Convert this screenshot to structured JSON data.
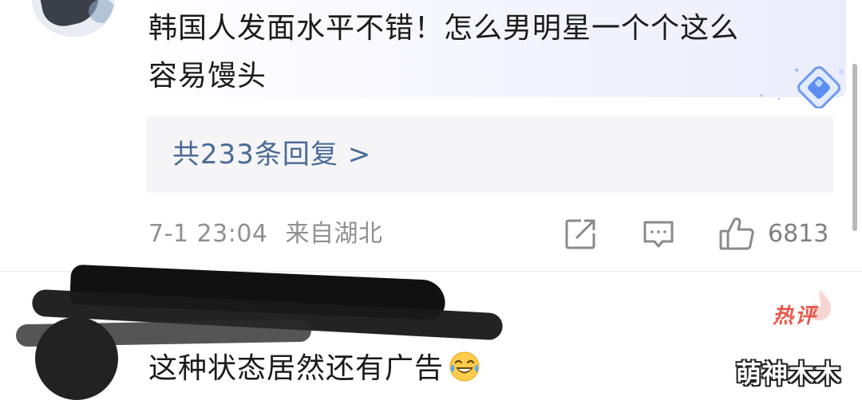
{
  "comment1": {
    "text_line1": "韩国人发面水平不错！怎么男明星一个个这么",
    "text_line2": "容易馒头",
    "replies_label": "共233条回复 >",
    "timestamp": "7-1 23:04",
    "location": "来自湖北",
    "like_count": "6813"
  },
  "comment2": {
    "hot_badge": "热评",
    "text": "这种状态居然还有广告",
    "emoji": "laughing-with-tears"
  },
  "watermark": "萌神木木",
  "colors": {
    "reply_link": "#4a6a96",
    "meta_gray": "#909090",
    "hot_red": "#e8574a",
    "badge_blue": "#5b8ef0"
  }
}
